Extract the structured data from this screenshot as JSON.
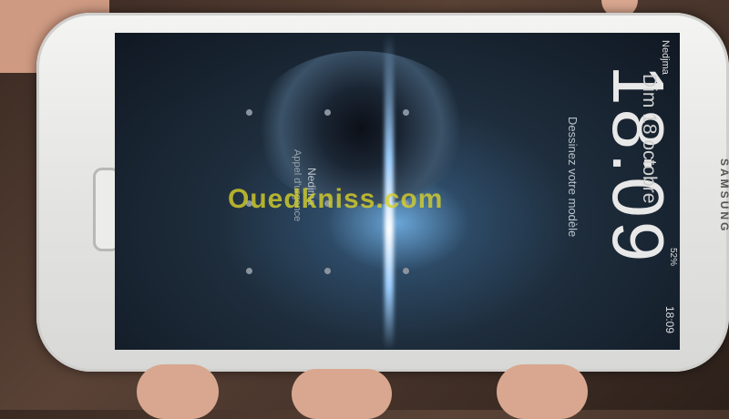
{
  "lock_screen": {
    "clock": "18:09",
    "date": "Dim 18 octobre",
    "carrier_top": "Nedjma",
    "carrier_left": "Nedjma",
    "unlock_hint": "Dessinez votre modèle",
    "emergency_call": "Appel d'urgence",
    "battery": "52%",
    "status_time": "18:09"
  },
  "device": {
    "brand": "SAMSUNG"
  },
  "watermark": "Ouedkniss.com"
}
